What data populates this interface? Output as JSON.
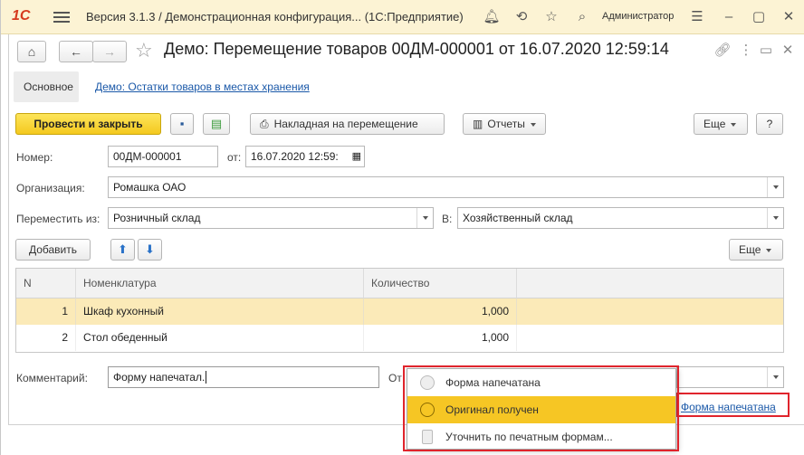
{
  "titlebar": {
    "logo": "1С",
    "title": "Версия 3.1.3 / Демонстрационная конфигурация... (1С:Предприятие)",
    "user": "Администратор"
  },
  "header": {
    "title": "Демо: Перемещение товаров 00ДМ-000001 от 16.07.2020 12:59:14"
  },
  "tabs": {
    "main": "Основное",
    "link": "Демо: Остатки товаров в местах хранения"
  },
  "toolbar": {
    "post_close": "Провести и закрыть",
    "waybill": "Накладная на перемещение",
    "reports": "Отчеты",
    "more": "Еще",
    "help": "?"
  },
  "fields": {
    "number_label": "Номер:",
    "number_value": "00ДМ-000001",
    "from_label": "от:",
    "date_value": "16.07.2020 12:59:",
    "org_label": "Организация:",
    "org_value": "Ромашка ОАО",
    "move_from_label": "Переместить из:",
    "move_from_value": "Розничный склад",
    "to_label": "В:",
    "to_value": "Хозяйственный склад"
  },
  "table_toolbar": {
    "add": "Добавить",
    "more": "Еще"
  },
  "table": {
    "columns": [
      "N",
      "Номенклатура",
      "Количество"
    ],
    "rows": [
      {
        "n": "1",
        "item": "Шкаф кухонный",
        "qty": "1,000"
      },
      {
        "n": "2",
        "item": "Стол обеденный",
        "qty": "1,000"
      }
    ]
  },
  "comment": {
    "label": "Комментарий:",
    "value": "Форму напечатал.",
    "other_label": "От"
  },
  "popup": {
    "items": [
      {
        "label": "Форма напечатана",
        "icon": "circle-gray-icon"
      },
      {
        "label": "Оригинал получен",
        "icon": "circle-yellow-icon"
      },
      {
        "label": "Уточнить по печатным формам...",
        "icon": "document-icon"
      }
    ]
  },
  "status": {
    "print_status": "Форма напечатана"
  },
  "colors": {
    "accent": "#f6c624",
    "link": "#1a58a8",
    "highlight_frame": "#e0242c",
    "selected_row": "#fbeab8"
  }
}
